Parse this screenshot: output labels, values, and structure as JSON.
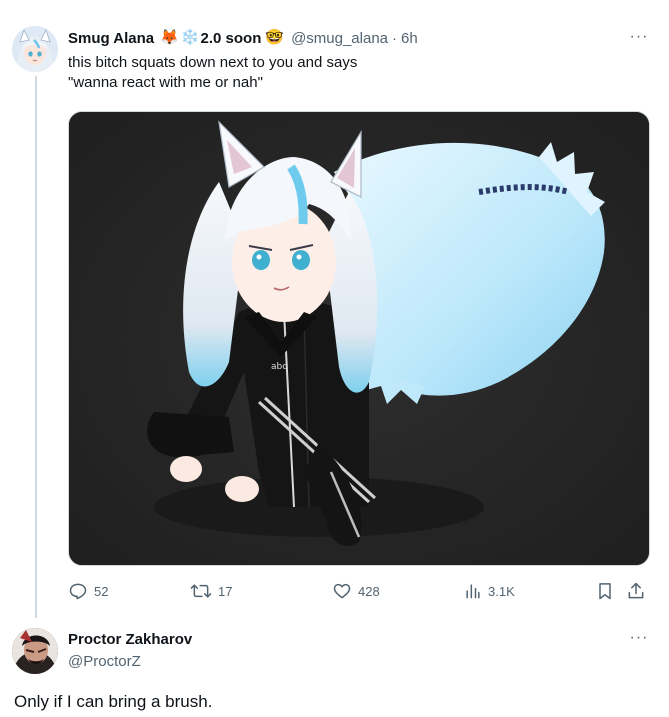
{
  "tweet": {
    "author_name": "Smug Alana",
    "badges": [
      "🦊",
      "❄️"
    ],
    "badge_text": "2.0 soon",
    "badge_after": "🤓",
    "handle": "@smug_alana",
    "separator": "·",
    "time": "6h",
    "more": "···",
    "text_lines": [
      "this bitch squats down next to you and says",
      "\"wanna react with me or nah\""
    ],
    "actions": {
      "replies": "52",
      "retweets": "17",
      "likes": "428",
      "views": "3.1K"
    }
  },
  "reply": {
    "author_name": "Proctor Zakharov",
    "handle": "@ProctorZ",
    "more": "···",
    "text": "Only if I can bring a brush."
  },
  "colors": {
    "text": "#0f1419",
    "muted": "#536471",
    "image_bg": "#262626"
  }
}
